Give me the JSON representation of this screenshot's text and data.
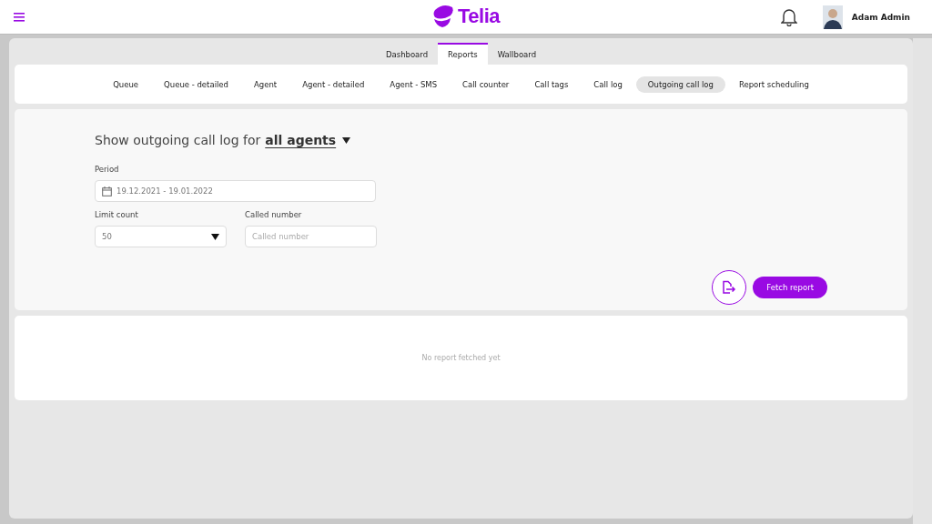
{
  "header": {
    "logo_text": "Telia",
    "user_name": "Adam Admin"
  },
  "tabs": [
    {
      "label": "Dashboard",
      "selected": false
    },
    {
      "label": "Reports",
      "selected": true
    },
    {
      "label": "Wallboard",
      "selected": false
    }
  ],
  "report_types": [
    {
      "label": "Queue",
      "selected": false
    },
    {
      "label": "Queue - detailed",
      "selected": false
    },
    {
      "label": "Agent",
      "selected": false
    },
    {
      "label": "Agent - detailed",
      "selected": false
    },
    {
      "label": "Agent - SMS",
      "selected": false
    },
    {
      "label": "Call counter",
      "selected": false
    },
    {
      "label": "Call tags",
      "selected": false
    },
    {
      "label": "Call log",
      "selected": false
    },
    {
      "label": "Outgoing call log",
      "selected": true
    },
    {
      "label": "Report scheduling",
      "selected": false
    }
  ],
  "form": {
    "heading": "Show outgoing call log for",
    "agent_filter": "all agents",
    "period": {
      "label": "Period",
      "value": "19.12.2021 - 19.01.2022"
    },
    "limit_count": {
      "label": "Limit count",
      "value": "50"
    },
    "called_number": {
      "label": "Called number",
      "placeholder": "Called number"
    },
    "fetch_button": "Fetch report"
  },
  "result": {
    "message": "No report fetched yet"
  }
}
